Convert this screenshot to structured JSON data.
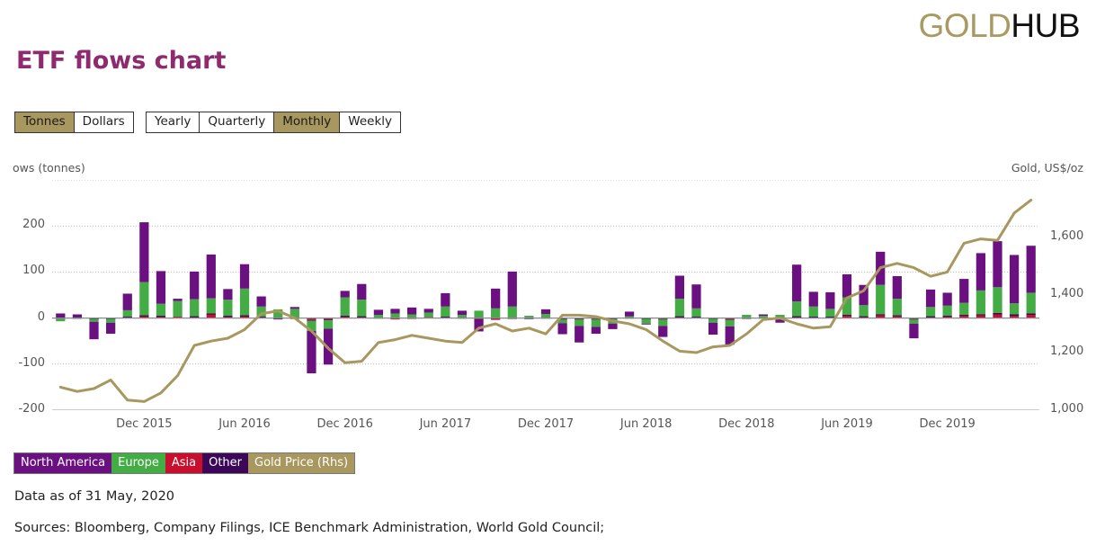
{
  "brand": {
    "part1": "GOLD",
    "part2": "HUB",
    "gold_color": "#a99a63"
  },
  "page_title": "ETF flows chart",
  "toggles": {
    "units": [
      {
        "label": "Tonnes",
        "active": true
      },
      {
        "label": "Dollars",
        "active": false
      }
    ],
    "frequency": [
      {
        "label": "Yearly",
        "active": false
      },
      {
        "label": "Quarterly",
        "active": false
      },
      {
        "label": "Monthly",
        "active": true
      },
      {
        "label": "Weekly",
        "active": false
      }
    ]
  },
  "legend": [
    {
      "label": "North America",
      "color": "#6b1080",
      "text_color": "#ffffff"
    },
    {
      "label": "Europe",
      "color": "#43ac45",
      "text_color": "#ffffff"
    },
    {
      "label": "Asia",
      "color": "#c8102e",
      "text_color": "#ffffff"
    },
    {
      "label": "Other",
      "color": "#3c0759",
      "text_color": "#ffffff"
    },
    {
      "label": "Gold Price (Rhs)",
      "color": "#a8985f",
      "text_color": "#ffffff"
    }
  ],
  "notes": {
    "data_as_of": "Data as of 31 May, 2020",
    "sources": "Sources: Bloomberg, Company Filings, ICE Benchmark Administration, World Gold Council;"
  },
  "chart_data": {
    "type": "bar",
    "title": "ETF flows chart",
    "subtype": "stacked bar with secondary-axis line",
    "ylabel": "ows (tonnes)",
    "ylabel_full": "Flows (tonnes)",
    "y2label": "Gold, US$/oz",
    "xlabel": "",
    "ylim": [
      -200,
      300
    ],
    "yticks": [
      200,
      100,
      0,
      -100,
      -200
    ],
    "ytick_labels": [
      "200",
      "100",
      "0",
      "-100",
      "-200"
    ],
    "y2lim": [
      1000,
      1800
    ],
    "y2ticks": [
      1600,
      1400,
      1200,
      1000
    ],
    "y2tick_labels": [
      "1,600",
      "1,400",
      "1,200",
      "1,000"
    ],
    "grid": true,
    "legend_position": "bottom-left",
    "xtick_labels": [
      "Dec 2015",
      "Jun 2016",
      "Dec 2016",
      "Jun 2017",
      "Dec 2017",
      "Jun 2018",
      "Dec 2018",
      "Jun 2019",
      "Dec 2019"
    ],
    "xtick_indices": [
      5,
      11,
      17,
      23,
      29,
      35,
      41,
      47,
      53
    ],
    "x": [
      "Jul 2015",
      "Aug 2015",
      "Sep 2015",
      "Oct 2015",
      "Nov 2015",
      "Dec 2015",
      "Jan 2016",
      "Feb 2016",
      "Mar 2016",
      "Apr 2016",
      "May 2016",
      "Jun 2016",
      "Jul 2016",
      "Aug 2016",
      "Sep 2016",
      "Oct 2016",
      "Nov 2016",
      "Dec 2016",
      "Jan 2017",
      "Feb 2017",
      "Mar 2017",
      "Apr 2017",
      "May 2017",
      "Jun 2017",
      "Jul 2017",
      "Aug 2017",
      "Sep 2017",
      "Oct 2017",
      "Nov 2017",
      "Dec 2017",
      "Jan 2018",
      "Feb 2018",
      "Mar 2018",
      "Apr 2018",
      "May 2018",
      "Jun 2018",
      "Jul 2018",
      "Aug 2018",
      "Sep 2018",
      "Oct 2018",
      "Nov 2018",
      "Dec 2018",
      "Jan 2019",
      "Feb 2019",
      "Mar 2019",
      "Apr 2019",
      "May 2019",
      "Jun 2019",
      "Jul 2019",
      "Aug 2019",
      "Sep 2019",
      "Oct 2019",
      "Nov 2019",
      "Dec 2019",
      "Jan 2020",
      "Feb 2020",
      "Mar 2020",
      "Apr 2020",
      "May 2020"
    ],
    "series": [
      {
        "name": "North America",
        "color": "#6b1080",
        "values": [
          10,
          8,
          -38,
          -24,
          36,
          130,
          71,
          5,
          60,
          95,
          23,
          53,
          22,
          -3,
          4,
          -92,
          -78,
          14,
          34,
          11,
          10,
          15,
          8,
          29,
          9,
          -26,
          43,
          76,
          -1,
          10,
          -24,
          -36,
          -15,
          -12,
          10,
          -2,
          -24,
          50,
          52,
          -26,
          -40,
          -2,
          3,
          -10,
          80,
          32,
          36,
          50,
          44,
          72,
          49,
          -32,
          38,
          28,
          52,
          81,
          100,
          105,
          102
        ]
      },
      {
        "name": "Europe",
        "color": "#43ac45",
        "values": [
          -6,
          -2,
          -6,
          -8,
          14,
          72,
          26,
          34,
          37,
          33,
          35,
          58,
          22,
          18,
          20,
          -22,
          -18,
          40,
          36,
          6,
          10,
          8,
          10,
          22,
          6,
          16,
          20,
          24,
          4,
          8,
          -8,
          -14,
          -16,
          -10,
          3,
          -10,
          -14,
          38,
          18,
          -8,
          -14,
          6,
          4,
          6,
          32,
          22,
          17,
          38,
          24,
          64,
          36,
          -9,
          20,
          22,
          26,
          52,
          56,
          24,
          45
        ]
      },
      {
        "name": "Asia",
        "color": "#c8102e",
        "values": [
          -1,
          0,
          -1,
          -1,
          2,
          5,
          4,
          3,
          3,
          9,
          4,
          5,
          2,
          1,
          -2,
          -4,
          -3,
          4,
          3,
          1,
          -3,
          -2,
          2,
          2,
          1,
          -2,
          -4,
          -2,
          1,
          1,
          -2,
          -2,
          -2,
          -1,
          1,
          -1,
          -2,
          3,
          2,
          -1,
          -3,
          1,
          1,
          1,
          3,
          2,
          2,
          5,
          3,
          6,
          4,
          -2,
          3,
          4,
          5,
          6,
          8,
          5,
          7
        ]
      },
      {
        "name": "Other",
        "color": "#3c0759",
        "values": [
          0,
          0,
          -1,
          -1,
          1,
          1,
          1,
          0,
          1,
          1,
          1,
          1,
          1,
          0,
          0,
          -2,
          -2,
          1,
          1,
          0,
          0,
          0,
          0,
          1,
          0,
          -1,
          1,
          1,
          0,
          0,
          -1,
          -1,
          -1,
          -1,
          0,
          -1,
          -1,
          1,
          1,
          -1,
          -1,
          0,
          0,
          0,
          1,
          1,
          1,
          2,
          1,
          2,
          2,
          -1,
          1,
          1,
          2,
          2,
          3,
          3,
          3
        ]
      }
    ],
    "line_series": {
      "name": "Gold Price (Rhs)",
      "color": "#a8985f",
      "axis": "right",
      "unit": "US$/oz",
      "values": [
        1080,
        1065,
        1075,
        1105,
        1035,
        1030,
        1060,
        1120,
        1225,
        1240,
        1250,
        1280,
        1335,
        1345,
        1320,
        1275,
        1215,
        1165,
        1170,
        1235,
        1245,
        1260,
        1250,
        1240,
        1235,
        1285,
        1300,
        1275,
        1285,
        1265,
        1330,
        1330,
        1325,
        1310,
        1300,
        1280,
        1240,
        1205,
        1200,
        1220,
        1225,
        1265,
        1315,
        1320,
        1300,
        1285,
        1290,
        1390,
        1415,
        1495,
        1510,
        1495,
        1465,
        1480,
        1580,
        1595,
        1590,
        1685,
        1730
      ]
    }
  }
}
